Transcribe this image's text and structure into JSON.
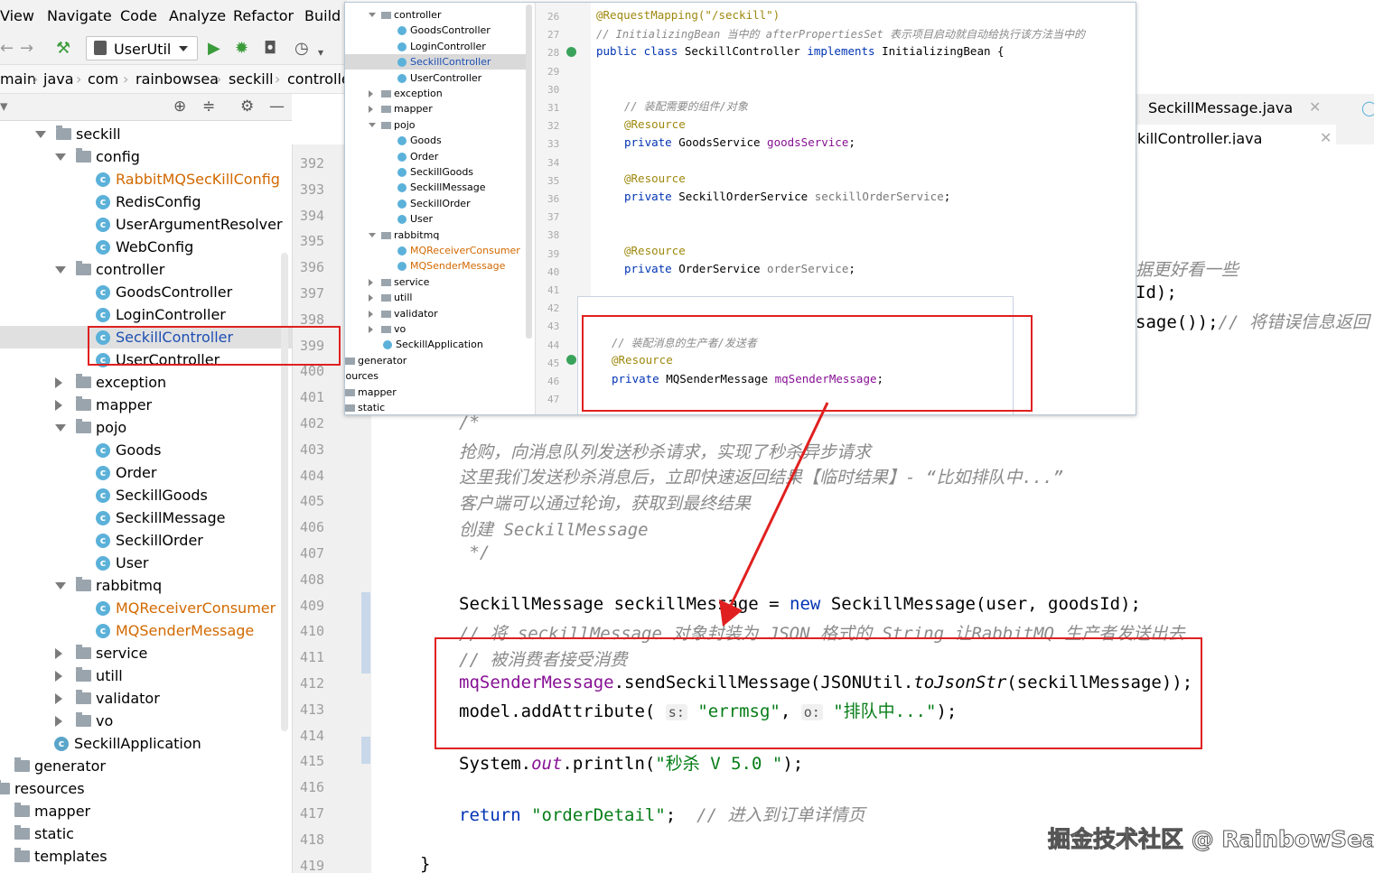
{
  "menu": [
    "View",
    "Navigate",
    "Code",
    "Analyze",
    "Refactor",
    "Build"
  ],
  "toolbar": {
    "run_config": "UserUtil"
  },
  "breadcrumb": [
    "main",
    "java",
    "com",
    "rainbowsea",
    "seckill",
    "controlle"
  ],
  "tree": [
    {
      "label": "seckill",
      "type": "folder",
      "open": true,
      "level": 0
    },
    {
      "label": "config",
      "type": "folder",
      "open": true,
      "level": 1
    },
    {
      "label": "RabbitMQSecKillConfig",
      "type": "class",
      "level": 2,
      "color": "orange"
    },
    {
      "label": "RedisConfig",
      "type": "class",
      "level": 2
    },
    {
      "label": "UserArgumentResolver",
      "type": "class",
      "level": 2
    },
    {
      "label": "WebConfig",
      "type": "class",
      "level": 2
    },
    {
      "label": "controller",
      "type": "folder",
      "open": true,
      "level": 1
    },
    {
      "label": "GoodsController",
      "type": "class",
      "level": 2
    },
    {
      "label": "LoginController",
      "type": "class",
      "level": 2
    },
    {
      "label": "SeckillController",
      "type": "class",
      "level": 2,
      "selected": true,
      "color": "blue"
    },
    {
      "label": "UserController",
      "type": "class",
      "level": 2
    },
    {
      "label": "exception",
      "type": "folder",
      "open": false,
      "level": 1
    },
    {
      "label": "mapper",
      "type": "folder",
      "open": false,
      "level": 1
    },
    {
      "label": "pojo",
      "type": "folder",
      "open": true,
      "level": 1
    },
    {
      "label": "Goods",
      "type": "class",
      "level": 2
    },
    {
      "label": "Order",
      "type": "class",
      "level": 2
    },
    {
      "label": "SeckillGoods",
      "type": "class",
      "level": 2
    },
    {
      "label": "SeckillMessage",
      "type": "class",
      "level": 2
    },
    {
      "label": "SeckillOrder",
      "type": "class",
      "level": 2
    },
    {
      "label": "User",
      "type": "class",
      "level": 2
    },
    {
      "label": "rabbitmq",
      "type": "folder",
      "open": true,
      "level": 1
    },
    {
      "label": "MQReceiverConsumer",
      "type": "class",
      "level": 2,
      "color": "orange"
    },
    {
      "label": "MQSenderMessage",
      "type": "class",
      "level": 2,
      "color": "orange"
    },
    {
      "label": "service",
      "type": "folder",
      "open": false,
      "level": 1
    },
    {
      "label": "utill",
      "type": "folder",
      "open": false,
      "level": 1
    },
    {
      "label": "validator",
      "type": "folder",
      "open": false,
      "level": 1
    },
    {
      "label": "vo",
      "type": "folder",
      "open": false,
      "level": 1
    },
    {
      "label": "SeckillApplication",
      "type": "app",
      "level": 1
    },
    {
      "label": "generator",
      "type": "folder",
      "level": -1
    },
    {
      "label": "resources",
      "type": "folder",
      "level": -2
    },
    {
      "label": "mapper",
      "type": "folder",
      "level": -1
    },
    {
      "label": "static",
      "type": "folder",
      "level": -1
    },
    {
      "label": "templates",
      "type": "folder",
      "level": -1
    }
  ],
  "line_numbers": [
    "392",
    "393",
    "394",
    "395",
    "396",
    "397",
    "398",
    "399",
    "400",
    "401",
    "402",
    "403",
    "404",
    "405",
    "406",
    "407",
    "408",
    "409",
    "410",
    "411",
    "412",
    "413",
    "414",
    "415",
    "416",
    "417",
    "418",
    "419"
  ],
  "tabs": {
    "tab1": "SeckillMessage.java",
    "tab2": "killController.java"
  },
  "editor": {
    "l396": "据更好看一些",
    "l397": "Id);",
    "l398a": "sage());",
    "l398b": "// 将错误信息返回",
    "l402": "/*",
    "l403": "抢购，向消息队列发送秒杀请求，实现了秒杀异步请求",
    "l404": "这里我们发送秒杀消息后，立即快速返回结果【临时结果】- “比如排队中...”",
    "l405": "客户端可以通过轮询，获取到最终结果",
    "l406": "创建 SeckillMessage",
    "l407": " */",
    "l409a": "SeckillMessage seckillMessage = ",
    "l409b": "new",
    "l409c": " SeckillMessage(user, goodsId);",
    "l410": "// 将 seckillMessage 对象封装为 JSON 格式的 String 让RabbitMQ 生产者发送出去",
    "l411": "// 被消费者接受消费",
    "l412a": "mqSenderMessage",
    "l412b": ".sendSeckillMessage(JSONUtil.",
    "l412c": "toJsonStr",
    "l412d": "(seckillMessage));",
    "l413a": "model.addAttribute(",
    "l413b": "s:",
    "l413c": "\"errmsg\"",
    "l413d": ", ",
    "l413e": "o:",
    "l413f": "\"排队中...\"",
    "l413g": ");",
    "l415a": "System.",
    "l415b": "out",
    "l415c": ".println(",
    "l415d": "\"秒杀 V 5.0 \"",
    "l415e": ");",
    "l417a": "return",
    "l417b": " \"orderDetail\"",
    "l417c": ";",
    "l417d": "  // 进入到订单详情页",
    "l419": "}"
  },
  "overlay": {
    "tree": [
      {
        "label": "controller",
        "type": "folder",
        "open": true,
        "lv": 0
      },
      {
        "label": "GoodsController",
        "type": "class",
        "lv": 1
      },
      {
        "label": "LoginController",
        "type": "class",
        "lv": 1
      },
      {
        "label": "SeckillController",
        "type": "class",
        "lv": 1,
        "selected": true,
        "color": "blue"
      },
      {
        "label": "UserController",
        "type": "class",
        "lv": 1
      },
      {
        "label": "exception",
        "type": "folder",
        "open": false,
        "lv": 0
      },
      {
        "label": "mapper",
        "type": "folder",
        "open": false,
        "lv": 0
      },
      {
        "label": "pojo",
        "type": "folder",
        "open": true,
        "lv": 0
      },
      {
        "label": "Goods",
        "type": "class",
        "lv": 1
      },
      {
        "label": "Order",
        "type": "class",
        "lv": 1
      },
      {
        "label": "SeckillGoods",
        "type": "class",
        "lv": 1
      },
      {
        "label": "SeckillMessage",
        "type": "class",
        "lv": 1
      },
      {
        "label": "SeckillOrder",
        "type": "class",
        "lv": 1
      },
      {
        "label": "User",
        "type": "class",
        "lv": 1
      },
      {
        "label": "rabbitmq",
        "type": "folder",
        "open": true,
        "lv": 0
      },
      {
        "label": "MQReceiverConsumer",
        "type": "class",
        "lv": 1,
        "color": "orange"
      },
      {
        "label": "MQSenderMessage",
        "type": "class",
        "lv": 1,
        "color": "orange"
      },
      {
        "label": "service",
        "type": "folder",
        "open": false,
        "lv": 0
      },
      {
        "label": "utill",
        "type": "folder",
        "open": false,
        "lv": 0
      },
      {
        "label": "validator",
        "type": "folder",
        "open": false,
        "lv": 0
      },
      {
        "label": "vo",
        "type": "folder",
        "open": false,
        "lv": 0
      },
      {
        "label": "SeckillApplication",
        "type": "app",
        "lv": 0
      },
      {
        "label": "generator",
        "type": "folder",
        "lv": -1
      },
      {
        "label": "esources",
        "type": "none",
        "lv": -2
      },
      {
        "label": "mapper",
        "type": "folder",
        "lv": -1
      },
      {
        "label": "static",
        "type": "folder",
        "lv": -1
      }
    ],
    "line_numbers": [
      "26",
      "27",
      "28",
      "29",
      "30",
      "31",
      "32",
      "33",
      "34",
      "35",
      "36",
      "37",
      "38",
      "39",
      "40",
      "41",
      "42",
      "43",
      "44",
      "45",
      "46",
      "47"
    ],
    "code": {
      "l26": "@RequestMapping(\"/seckill\")",
      "l27": "// InitializingBean 当中的 afterPropertiesSet 表示项目启动就自动给执行该方法当中的",
      "l28a": "public class",
      "l28b": " SeckillController ",
      "l28c": "implements",
      "l28d": " InitializingBean {",
      "l31": "// 装配需要的组件/对象",
      "l32": "@Resource",
      "l33a": "private",
      "l33b": " GoodsService ",
      "l33c": "goodsService",
      "l33d": ";",
      "l35": "@Resource",
      "l36a": "private",
      "l36b": " SeckillOrderService ",
      "l36c": "seckillOrderService",
      "l36d": ";",
      "l39": "@Resource",
      "l40a": "private",
      "l40b": " OrderService ",
      "l40c": "orderService",
      "l40d": ";",
      "l44": "// 装配消息的生产者/发送者",
      "l45": "@Resource",
      "l46a": "private",
      "l46b": " MQSenderMessage ",
      "l46c": "mqSenderMessage",
      "l46d": ";"
    }
  },
  "watermark": "掘金技术社区 @ RainbowSea",
  "colors": {
    "annotation_red": "#e02020",
    "keyword": "#0033b3",
    "string": "#067d17",
    "field": "#871094"
  }
}
